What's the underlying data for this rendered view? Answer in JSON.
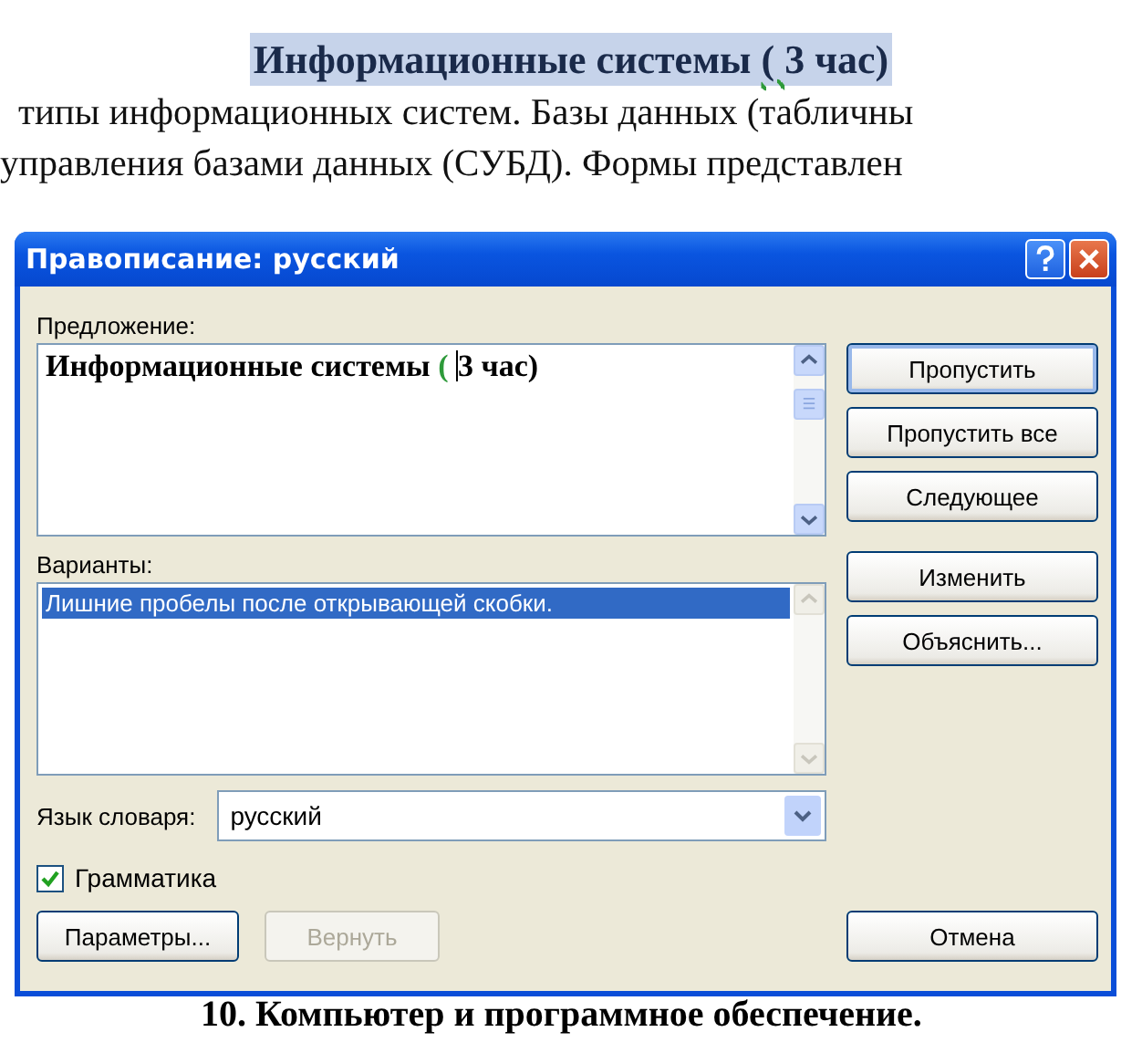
{
  "document": {
    "heading": {
      "selected": true,
      "parts": [
        {
          "text": "Информационные системы ",
          "error": false
        },
        {
          "text": "( ",
          "error": true
        },
        {
          "text": "3 час)",
          "error": false
        }
      ]
    },
    "lines": [
      "типы информационных систем. Базы данных (табличны",
      "управления базами данных (СУБД). Формы представлен"
    ],
    "footer_heading": "10. Компьютер и программное обеспечение."
  },
  "dialog": {
    "title": "Правописание: русский",
    "sentence_label": "Предложение:",
    "sentence": [
      {
        "text": "Информационные системы ",
        "error": false
      },
      {
        "text": "( ",
        "error": true
      },
      {
        "text": "3 час)",
        "error": false
      }
    ],
    "top_buttons": [
      {
        "label": "Пропустить",
        "default": true,
        "disabled": false
      },
      {
        "label": "Пропустить все",
        "default": false,
        "disabled": false
      },
      {
        "label": "Следующее",
        "default": false,
        "disabled": false
      }
    ],
    "suggestions_label": "Варианты:",
    "suggestions": [
      {
        "text": "Лишние пробелы после открывающей скобки.",
        "selected": true
      }
    ],
    "middle_buttons": [
      {
        "label": "Изменить",
        "default": false,
        "disabled": false
      },
      {
        "label": "Объяснить...",
        "default": false,
        "disabled": false
      }
    ],
    "language_label": "Язык словаря:",
    "language": "русский",
    "grammar": {
      "label": "Грамматика",
      "checked": true
    },
    "bottom_left_buttons": [
      {
        "label": "Параметры...",
        "default": false,
        "disabled": false
      },
      {
        "label": "Вернуть",
        "default": false,
        "disabled": true
      }
    ],
    "cancel_button": {
      "label": "Отмена",
      "default": false,
      "disabled": false
    }
  }
}
